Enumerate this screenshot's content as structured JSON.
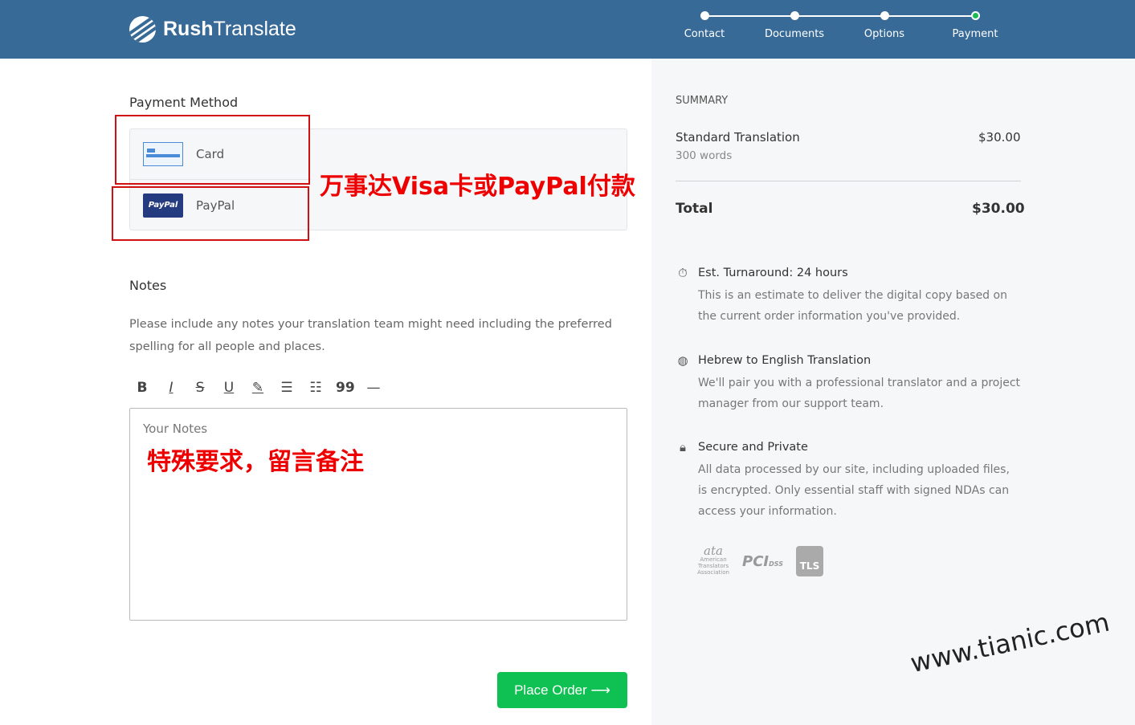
{
  "header": {
    "brand_bold": "Rush",
    "brand_light": "Translate",
    "steps": [
      {
        "label": "Contact"
      },
      {
        "label": "Documents"
      },
      {
        "label": "Options"
      },
      {
        "label": "Payment",
        "active": true
      }
    ],
    "bg_color": "#386a98",
    "active_color": "#1db954"
  },
  "payment": {
    "title": "Payment Method",
    "options": [
      {
        "label": "Card",
        "icon": "credit-card-icon"
      },
      {
        "label": "PayPal",
        "icon": "paypal-icon",
        "icon_text": "PayPal"
      }
    ],
    "annotation": "万事达Visa卡或PayPal付款"
  },
  "notes": {
    "title": "Notes",
    "description": "Please include any notes your translation team might need including the preferred spelling for all people and places.",
    "toolbar": [
      "bold",
      "italic",
      "strikethrough",
      "underline",
      "highlight",
      "bullet-list",
      "numbered-list",
      "quote",
      "horizontal-rule"
    ],
    "placeholder": "Your Notes",
    "annotation": "特殊要求，留言备注"
  },
  "place_order": "Place Order ⟶",
  "summary": {
    "heading": "SUMMARY",
    "item": "Standard Translation",
    "item_price": "$30.00",
    "item_sub": "300 words",
    "total_label": "Total",
    "total_value": "$30.00",
    "features": [
      {
        "title": "Est. Turnaround: 24 hours",
        "body": "This is an estimate to deliver the digital copy based on the current order information you've provided.",
        "icon": "clock-icon"
      },
      {
        "title": "Hebrew to English Translation",
        "body": "We'll pair you with a professional translator and a project manager from our support team.",
        "icon": "globe-icon"
      },
      {
        "title": "Secure and Private",
        "body": "All data processed by our site, including uploaded files, is encrypted. Only essential staff with signed NDAs can access your information.",
        "icon": "lock-icon"
      }
    ],
    "badges": [
      "ata American Translators Association",
      "PCI DSS",
      "TLS"
    ]
  },
  "watermark": "www.tianic.com"
}
